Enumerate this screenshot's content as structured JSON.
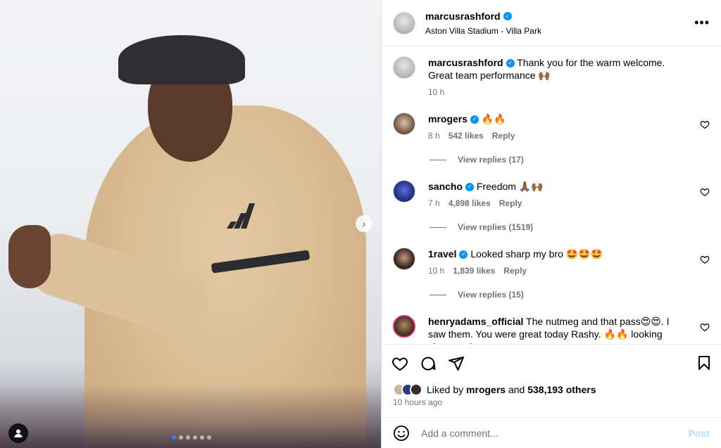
{
  "post": {
    "author": "marcusrashford",
    "location": "Aston Villa Stadium - Villa Park",
    "more_label": "•••"
  },
  "caption": {
    "username": "marcusrashford",
    "text": "Thank you for the warm welcome. Great team performance 🙌🏾",
    "time": "10 h"
  },
  "comments": [
    {
      "username": "mrogers",
      "text": "🔥🔥",
      "time": "8 h",
      "likes": "542 likes",
      "reply_label": "Reply",
      "view_replies": "View replies (17)"
    },
    {
      "username": "sancho",
      "text": "Freedom 🙏🏾🙌🏾",
      "time": "7 h",
      "likes": "4,898 likes",
      "reply_label": "Reply",
      "view_replies": "View replies (1519)"
    },
    {
      "username": "1ravel",
      "text": "Looked sharp my bro 🤩🤩🤩",
      "time": "10 h",
      "likes": "1,839 likes",
      "reply_label": "Reply",
      "view_replies": "View replies (15)"
    },
    {
      "username": "henryadams_official",
      "text": "The nutmeg and that pass😍😍. I saw them. You were great today Rashy. 🔥🔥 looking sharp and"
    }
  ],
  "likes": {
    "prefix": "Liked by",
    "user": "mrogers",
    "joiner": "and",
    "others": "538,193 others"
  },
  "time_ago": "10 hours ago",
  "add_comment": {
    "placeholder": "Add a comment...",
    "post_label": "Post"
  },
  "colors": {
    "verified": "#0095f6",
    "link_disabled": "#b3dbff",
    "secondary_text": "#737373"
  }
}
